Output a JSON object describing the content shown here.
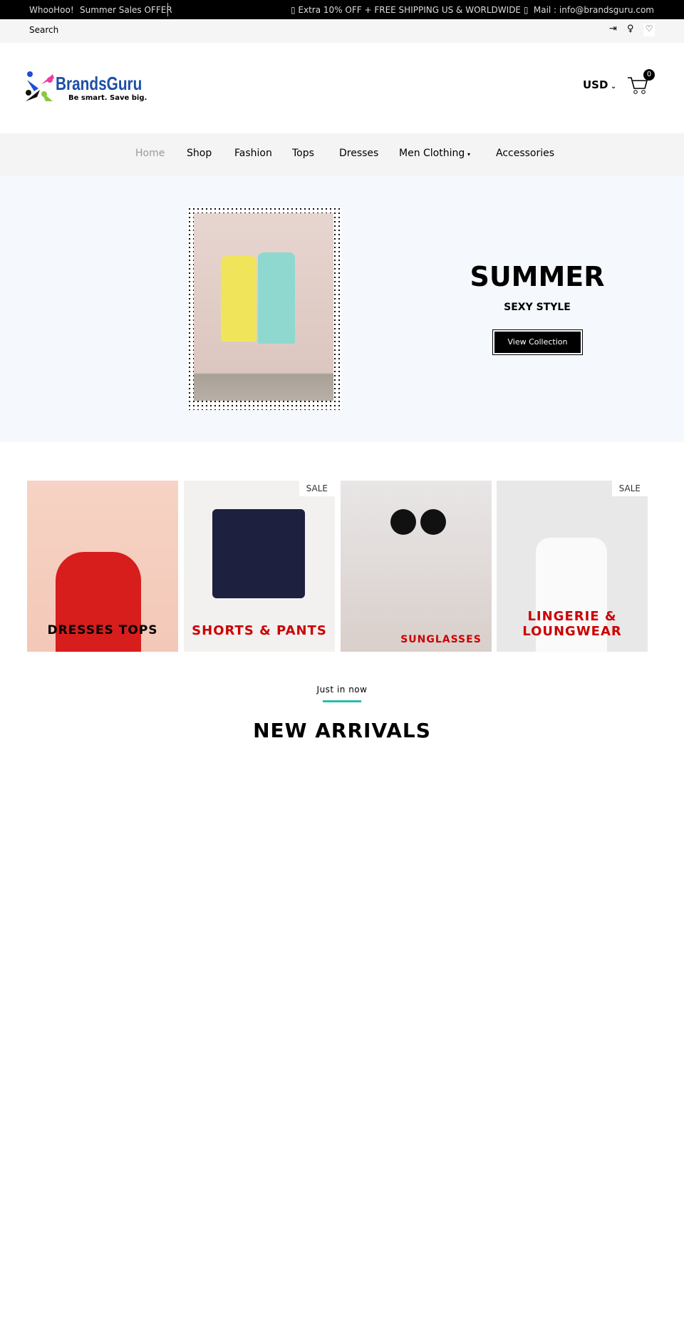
{
  "topbar": {
    "whoohoo": "WhooHoo!",
    "offer": "Summer Sales OFFER",
    "promo": "▯ Extra 10% OFF + FREE SHIPPING US & WORLDWIDE ▯",
    "mail": "Mail : info@brandsguru.com"
  },
  "searchbar": {
    "search_label": "Search",
    "icons": [
      "login-icon",
      "user-icon",
      "heart-icon"
    ]
  },
  "header": {
    "logo_text": "BrandsGuru",
    "logo_tagline": "Be smart. Save big.",
    "currency": "USD",
    "cart_count": "0"
  },
  "nav": {
    "items": [
      {
        "label": "Home",
        "active": true
      },
      {
        "label": "Shop"
      },
      {
        "label": "Fashion"
      },
      {
        "label": "Tops"
      },
      {
        "label": "Dresses"
      },
      {
        "label": "Men Clothing",
        "dropdown": true
      },
      {
        "label": "Accessories"
      }
    ]
  },
  "hero": {
    "title": "SUMMER",
    "subtitle": "SEXY STYLE",
    "button": "View Collection"
  },
  "banners": [
    {
      "label": "DRESSES TOPS",
      "color": "#000000"
    },
    {
      "label": "SHORTS & PANTS",
      "color": "#cc0000",
      "badge": "SALE"
    },
    {
      "label": "SUNGLASSES",
      "color": "#cc0000"
    },
    {
      "label": "LINGERIE & LOUNGWEAR",
      "color": "#cc0000",
      "badge": "SALE"
    }
  ],
  "arrivals": {
    "kicker": "Just in now",
    "title": "NEW ARRIVALS",
    "accent": "#2bbbad"
  }
}
